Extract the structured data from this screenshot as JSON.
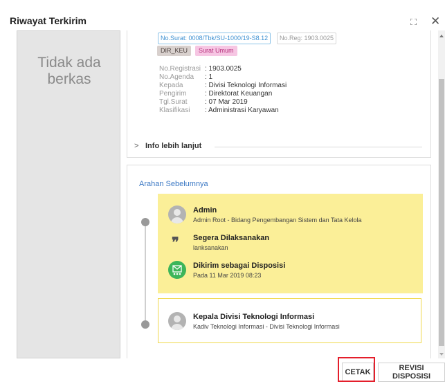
{
  "dialog": {
    "title": "Riwayat Terkirim"
  },
  "left_pane": {
    "no_file_line1": "Tidak ada",
    "no_file_line2": "berkas"
  },
  "letter": {
    "tag_no_surat": "No.Surat: 0008/Tbk/SU-1000/19-S8.12",
    "tag_no_reg": "No.Reg: 1903.0025",
    "tag_unit": "DIR_KEU",
    "tag_category": "Surat Umum",
    "fields": [
      {
        "label": "No.Registrasi",
        "value": ": 1903.0025"
      },
      {
        "label": "No.Agenda",
        "value": ": 1"
      },
      {
        "label": "Kepada",
        "value": ": Divisi Teknologi Informasi"
      },
      {
        "label": "Pengirim",
        "value": ": Direktorat Keuangan"
      },
      {
        "label": "Tgl.Surat",
        "value": ": 07 Mar 2019"
      },
      {
        "label": "Klasifikasi",
        "value": ": Administrasi Karyawan"
      }
    ],
    "more_info_label": "Info lebih lanjut"
  },
  "history": {
    "heading": "Arahan Sebelumnya",
    "entry1": {
      "sender_name": "Admin",
      "sender_role": "Admin Root - Bidang Pengembangan Sistem dan Tata Kelola",
      "instruction_title": "Segera Dilaksanakan",
      "instruction_note": "lanksanakan",
      "status_title": "Dikirim sebagai Disposisi",
      "status_time": "Pada 11 Mar 2019 08:23"
    },
    "entry2": {
      "recipient_name": "Kepala Divisi Teknologi Informasi",
      "recipient_role": "Kadiv Teknologi Informasi - Divisi Teknologi Informasi"
    }
  },
  "footer": {
    "print_label": "CETAK",
    "revise_label": "REVISI DISPOSISI"
  },
  "colors": {
    "highlight": "#e41e2b",
    "yellow": "#fbef98",
    "link": "#3b78c4",
    "green": "#3cb55a"
  }
}
